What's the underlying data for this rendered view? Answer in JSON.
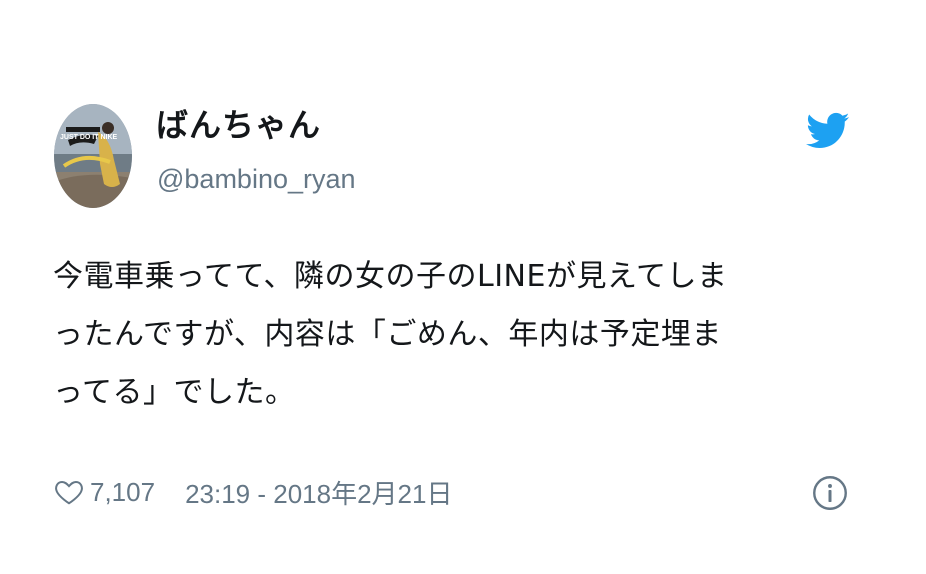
{
  "user": {
    "display_name": "ばんちゃん",
    "handle": "@bambino_ryan",
    "avatar_icon": "profile-photo",
    "avatar_text": "JUST DO IT NIKE"
  },
  "tweet": {
    "lines": [
      "今電車乗ってて、隣の女の子のLINEが見えてしま",
      "ったんですが、内容は「ごめん、年内は予定埋ま",
      "ってる」でした。"
    ]
  },
  "footer": {
    "like_icon": "heart-outline-icon",
    "likes": "7,107",
    "timestamp": "23:19 - 2018年2月21日",
    "info_icon": "info-icon"
  },
  "brand": {
    "logo_icon": "twitter-bird-icon",
    "accent_color": "#1da1f2",
    "muted_color": "#657786"
  }
}
